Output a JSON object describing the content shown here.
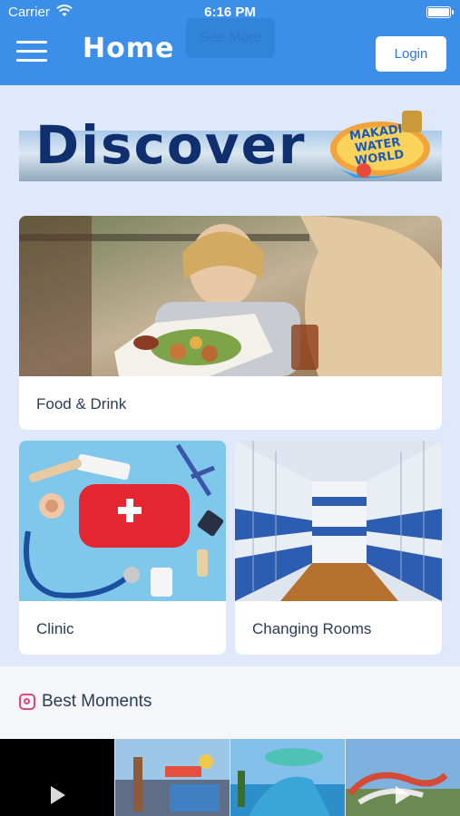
{
  "status_bar": {
    "carrier": "Carrier",
    "time": "6:16 PM"
  },
  "header": {
    "title": "Home",
    "ghost_button": "See More",
    "login": "Login"
  },
  "banner": {
    "heading": "Discover",
    "logo_text": [
      "MAKADI",
      "WATER",
      "WORLD"
    ]
  },
  "cards": [
    {
      "label": "Food & Drink"
    },
    {
      "label": "Clinic"
    },
    {
      "label": "Changing Rooms"
    }
  ],
  "moments": {
    "label": "Best Moments"
  },
  "colors": {
    "header": "#3b8fe8",
    "background": "#dfe9fb",
    "text": "#2b3c55",
    "instagram": "#e0457b"
  },
  "icons": [
    "menu-icon",
    "wifi-icon",
    "battery-icon",
    "instagram-icon",
    "play-icon"
  ]
}
